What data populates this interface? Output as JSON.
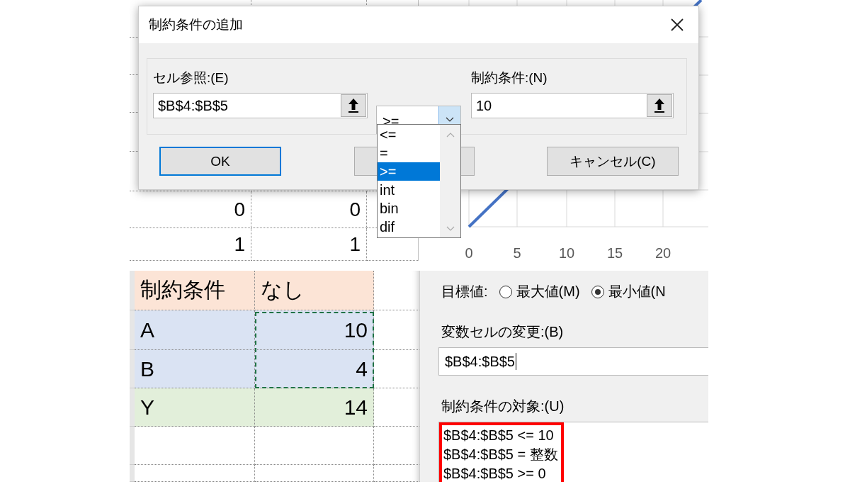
{
  "sheet_top": {
    "rows": [
      {
        "cells": [
          "0",
          "0"
        ]
      },
      {
        "cells": [
          "1",
          "1"
        ]
      }
    ]
  },
  "chart": {
    "x_labels": [
      "0",
      "5",
      "10",
      "15",
      "20"
    ]
  },
  "dialog": {
    "title": "制約条件の追加",
    "cell_ref": {
      "label": "セル参照:(E)",
      "value": "$B$4:$B$5"
    },
    "operator": {
      "value": ">=",
      "options": [
        {
          "label": "<=",
          "selected": false
        },
        {
          "label": "=",
          "selected": false
        },
        {
          "label": ">=",
          "selected": true
        },
        {
          "label": "int",
          "selected": false
        },
        {
          "label": "bin",
          "selected": false
        },
        {
          "label": "dif",
          "selected": false
        }
      ]
    },
    "constraint": {
      "label": "制約条件:(N)",
      "value": "10"
    },
    "buttons": [
      {
        "label": "OK",
        "focused": true
      },
      {
        "label": "キャンセル(C)",
        "focused": false
      }
    ]
  },
  "sheet_bottom": {
    "rows": [
      {
        "label": "制約条件",
        "value": "なし",
        "kind": "header"
      },
      {
        "label": "A",
        "value": "10",
        "kind": "variable"
      },
      {
        "label": "B",
        "value": "4",
        "kind": "variable"
      },
      {
        "label": "Y",
        "value": "14",
        "kind": "result"
      }
    ]
  },
  "solver": {
    "objective": {
      "label": "目標値:",
      "options": [
        {
          "label": "最大値(M)",
          "selected": false
        },
        {
          "label": "最小値(N",
          "selected": true
        }
      ]
    },
    "variable_cells": {
      "label": "変数セルの変更:(B)",
      "value": "$B$4:$B$5"
    },
    "constraints": {
      "label": "制約条件の対象:(U)",
      "highlighted": true,
      "items": [
        "$B$4:$B$5 <= 10",
        "$B$4:$B$5 = 整数",
        "$B$4:$B$5 >= 0"
      ]
    }
  }
}
